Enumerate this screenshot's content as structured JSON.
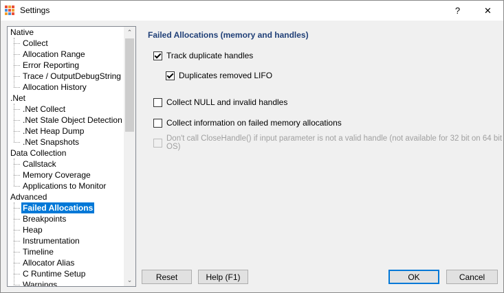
{
  "window": {
    "title": "Settings",
    "help_glyph": "?",
    "close_glyph": "✕"
  },
  "tree": {
    "items": [
      {
        "label": "Native",
        "level": 0
      },
      {
        "label": "Collect",
        "level": 1
      },
      {
        "label": "Allocation Range",
        "level": 1
      },
      {
        "label": "Error Reporting",
        "level": 1
      },
      {
        "label": "Trace / OutputDebugString",
        "level": 1
      },
      {
        "label": "Allocation History",
        "level": 1
      },
      {
        "label": ".Net",
        "level": 0
      },
      {
        "label": ".Net Collect",
        "level": 1
      },
      {
        "label": ".Net Stale Object Detection",
        "level": 1
      },
      {
        "label": ".Net Heap Dump",
        "level": 1
      },
      {
        "label": ".Net Snapshots",
        "level": 1
      },
      {
        "label": "Data Collection",
        "level": 0
      },
      {
        "label": "Callstack",
        "level": 1
      },
      {
        "label": "Memory Coverage",
        "level": 1
      },
      {
        "label": "Applications to Monitor",
        "level": 1
      },
      {
        "label": "Advanced",
        "level": 0
      },
      {
        "label": "Failed Allocations",
        "level": 1,
        "selected": true
      },
      {
        "label": "Breakpoints",
        "level": 1
      },
      {
        "label": "Heap",
        "level": 1
      },
      {
        "label": "Instrumentation",
        "level": 1
      },
      {
        "label": "Timeline",
        "level": 1
      },
      {
        "label": "Allocator Alias",
        "level": 1
      },
      {
        "label": "C Runtime Setup",
        "level": 1
      },
      {
        "label": "Warnings",
        "level": 1
      }
    ],
    "scroll_up_glyph": "⌃",
    "scroll_down_glyph": "⌄"
  },
  "panel": {
    "title": "Failed Allocations (memory and handles)",
    "options": {
      "track_duplicate": {
        "label": "Track duplicate handles",
        "checked": true,
        "enabled": true
      },
      "duplicates_lifo": {
        "label": "Duplicates removed LIFO",
        "checked": true,
        "enabled": true
      },
      "collect_null": {
        "label": "Collect NULL and invalid handles",
        "checked": false,
        "enabled": true
      },
      "collect_failed": {
        "label": "Collect information on failed memory allocations",
        "checked": false,
        "enabled": true
      },
      "dont_call_close": {
        "label": "Don't call CloseHandle() if input parameter is not a valid handle (not available for 32 bit on 64 bit OS)",
        "checked": false,
        "enabled": false
      }
    }
  },
  "buttons": {
    "reset": "Reset",
    "help": "Help (F1)",
    "ok": "OK",
    "cancel": "Cancel"
  },
  "colors": {
    "selection": "#0078d7",
    "section_title": "#1f3f77"
  }
}
